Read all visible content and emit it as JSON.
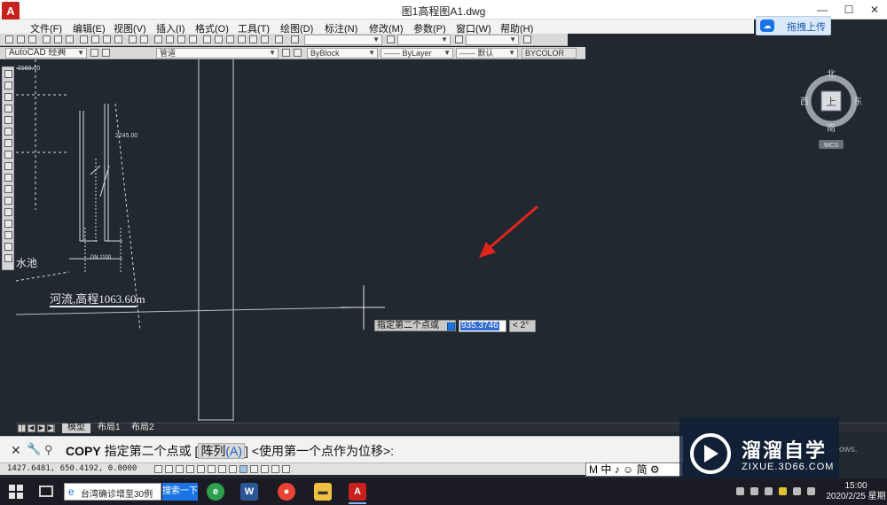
{
  "window": {
    "title": "图1高程图A1.dwg",
    "minimize_label": "—",
    "restore_label": "☐",
    "close_label": "✕"
  },
  "menu": [
    "文件(F)",
    "编辑(E)",
    "视图(V)",
    "插入(I)",
    "格式(O)",
    "工具(T)",
    "绘图(D)",
    "标注(N)",
    "修改(M)",
    "参数(P)",
    "窗口(W)",
    "帮助(H)"
  ],
  "upload_button": {
    "label": "拖拽上传",
    "icon": "baidu-cloud-icon"
  },
  "toolbar": {
    "workspace": "AutoCAD 经典",
    "layer": "管道",
    "color": "ByBlock",
    "linetype": "ByLayer",
    "lineweight": "默认",
    "plotstyle": "BYCOLOR"
  },
  "drawing": {
    "annotation_river": "河流,高程1063.60m",
    "annotation_pool": "水池",
    "annotation_dn": "DN 1100",
    "dim_1": "2160.00",
    "dim_2": "2245.00"
  },
  "viewcube": {
    "north": "北",
    "south": "南",
    "east": "东",
    "west": "西",
    "face": "上",
    "wcs": "WCS"
  },
  "dynamic_input": {
    "prompt": "指定第二个点或",
    "value": "935.3746",
    "angle": "< 2°"
  },
  "layout_tabs": [
    "模型",
    "布局1",
    "布局2"
  ],
  "command_line": {
    "command": "COPY",
    "prompt_before": " 指定第二个点或 [",
    "option_label": "阵列",
    "option_key": "(A)",
    "prompt_after": "] <使用第一个点作为位移>:"
  },
  "status_bar": {
    "coords": "1427.6481,  650.4192,  0.0000"
  },
  "ime_text": "M 中 ♪ ☺ 简 ⚙",
  "watermark": {
    "title": "溜溜自学",
    "url": "ZIXUE.3D66.COM"
  },
  "windows_hint": "ows.",
  "taskbar": {
    "search_text": "台湾确诊增至30例",
    "search_button": "搜索一下",
    "time": "15:00",
    "date": "2020/2/25 星期"
  },
  "colors": {
    "canvas_bg": "#212830",
    "arrow": "#e1251b",
    "selection": "#2e6bd4",
    "taskbar": "#1b1b24"
  }
}
